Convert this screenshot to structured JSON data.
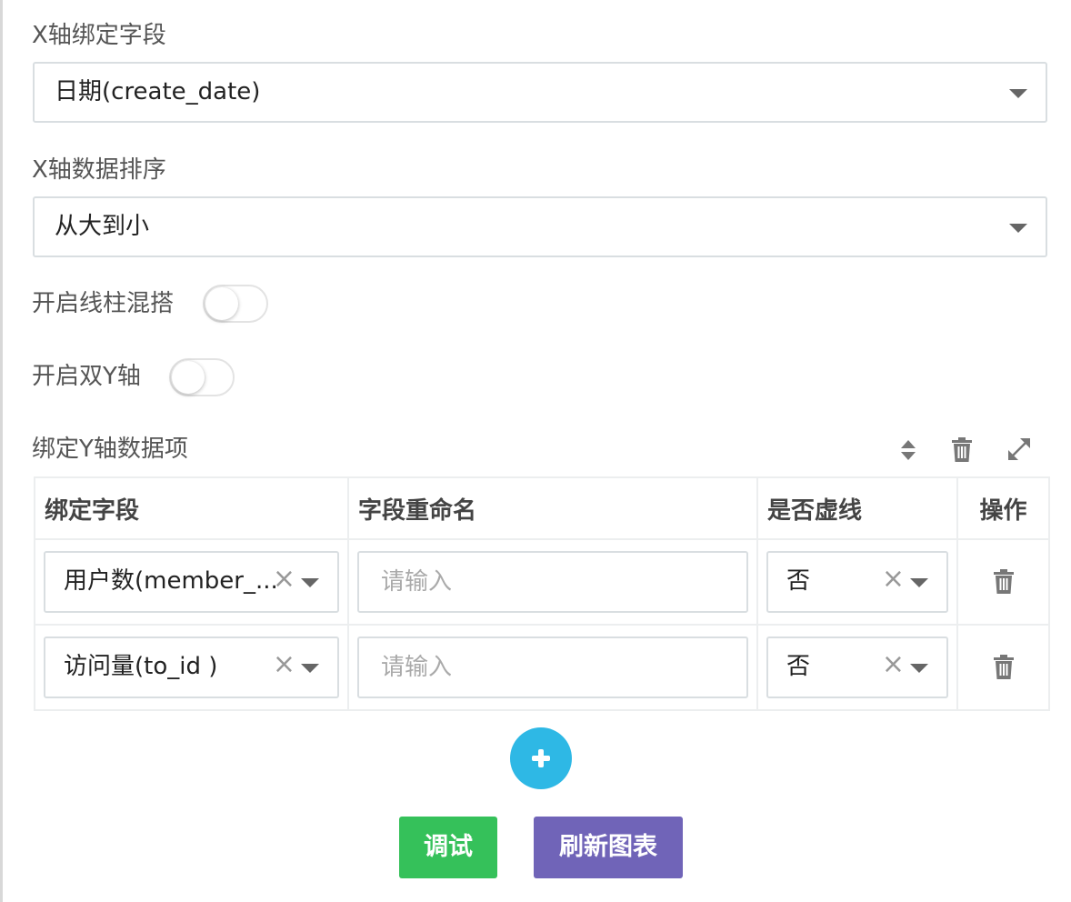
{
  "xaxis_field": {
    "label": "X轴绑定字段",
    "value": "日期(create_date)"
  },
  "xaxis_sort": {
    "label": "X轴数据排序",
    "value": "从大到小"
  },
  "mix_toggle": {
    "label": "开启线柱混搭",
    "on": false
  },
  "dual_y_toggle": {
    "label": "开启双Y轴",
    "on": false
  },
  "yaxis_section": {
    "title": "绑定Y轴数据项",
    "toolbar_icons": [
      "sort-icon",
      "trash-icon",
      "expand-icon"
    ]
  },
  "table": {
    "headers": [
      "绑定字段",
      "字段重命名",
      "是否虚线",
      "操作"
    ],
    "rows": [
      {
        "field": "用户数(member_...",
        "rename_value": "",
        "rename_placeholder": "请输入",
        "dashed": "否"
      },
      {
        "field": "访问量(to_id )",
        "rename_value": "",
        "rename_placeholder": "请输入",
        "dashed": "否"
      }
    ]
  },
  "actions": {
    "debug_label": "调试",
    "refresh_label": "刷新图表"
  },
  "colors": {
    "add_button": "#2eb8e5",
    "debug_button": "#35c15a",
    "refresh_button": "#7064b8"
  }
}
